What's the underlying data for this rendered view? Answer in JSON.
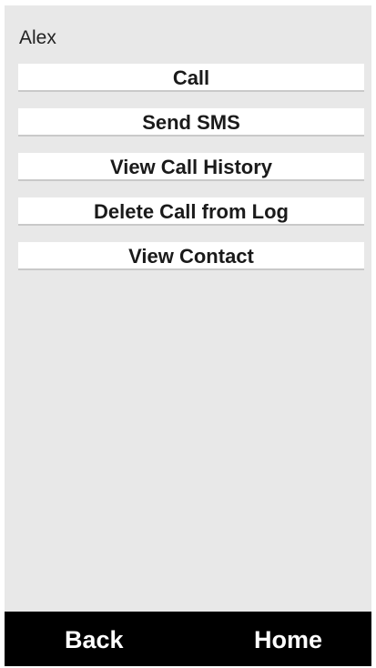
{
  "contact": {
    "name": "Alex"
  },
  "actions": [
    {
      "label": "Call"
    },
    {
      "label": "Send SMS"
    },
    {
      "label": "View Call History"
    },
    {
      "label": "Delete Call from Log"
    },
    {
      "label": "View Contact"
    }
  ],
  "bottom_bar": {
    "back_label": "Back",
    "home_label": "Home"
  },
  "colors": {
    "screen_background": "#e8e8e8",
    "button_background": "#ffffff",
    "bottom_bar_background": "#000000"
  }
}
